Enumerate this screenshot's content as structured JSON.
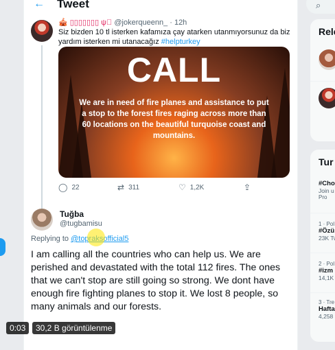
{
  "header": {
    "title": "Tweet"
  },
  "tweet1": {
    "user_emoji": "🎪 ▯▯▯▯▯▯▯ ψ⃝",
    "handle_time": "@jokerqueenn_ · 12h",
    "text": "Siz bizden 10 tl isterken kafamıza çay atarken utanmıyorsunuz da biz yardım isterken mi utanacağız ",
    "hashtag": "#helpturkey",
    "media": {
      "title": "CALL",
      "body": "We are in need of fire planes and assistance to put a stop to the forest fires raging across more than 60 locations on the beautiful turquoise coast and mountains."
    },
    "actions": {
      "replies": "22",
      "retweets": "311",
      "likes": "1,2K"
    }
  },
  "tweet2": {
    "name": "Tuğba",
    "handle": "@tugbamisu",
    "replying_label": "Replying to ",
    "replying_to": "@topraksofficial5",
    "text": "I am calling all the countries who can help us. We are perished and devastated with the total 112 fires. The ones that we can't stop are still going so strong. We dont have enough fire fighting planes to stop it. We lost 8 people, so many animals and our forests."
  },
  "sidebar": {
    "relevant_title": "Rele",
    "trends_title": "Tur",
    "trends": [
      {
        "top": "",
        "name": "#Cho",
        "sub": "Join u",
        "extra": "Pro"
      },
      {
        "top": "1 · Pol",
        "name": "#Özü",
        "sub": "23K Tw",
        "extra": ""
      },
      {
        "top": "2 · Pol",
        "name": "#izm",
        "sub": "14,1K",
        "extra": ""
      },
      {
        "top": "3 · Tre",
        "name": "Hafta",
        "sub": "4,258",
        "extra": ""
      }
    ]
  },
  "video": {
    "time": "0:03",
    "views": "30,2 B görüntülenme"
  },
  "colors": {
    "accent": "#1d9bf0",
    "text": "#0f1419",
    "muted": "#536471"
  },
  "icons": [
    "back-arrow-icon",
    "reply-icon",
    "retweet-icon",
    "like-icon",
    "share-icon",
    "search-icon"
  ]
}
